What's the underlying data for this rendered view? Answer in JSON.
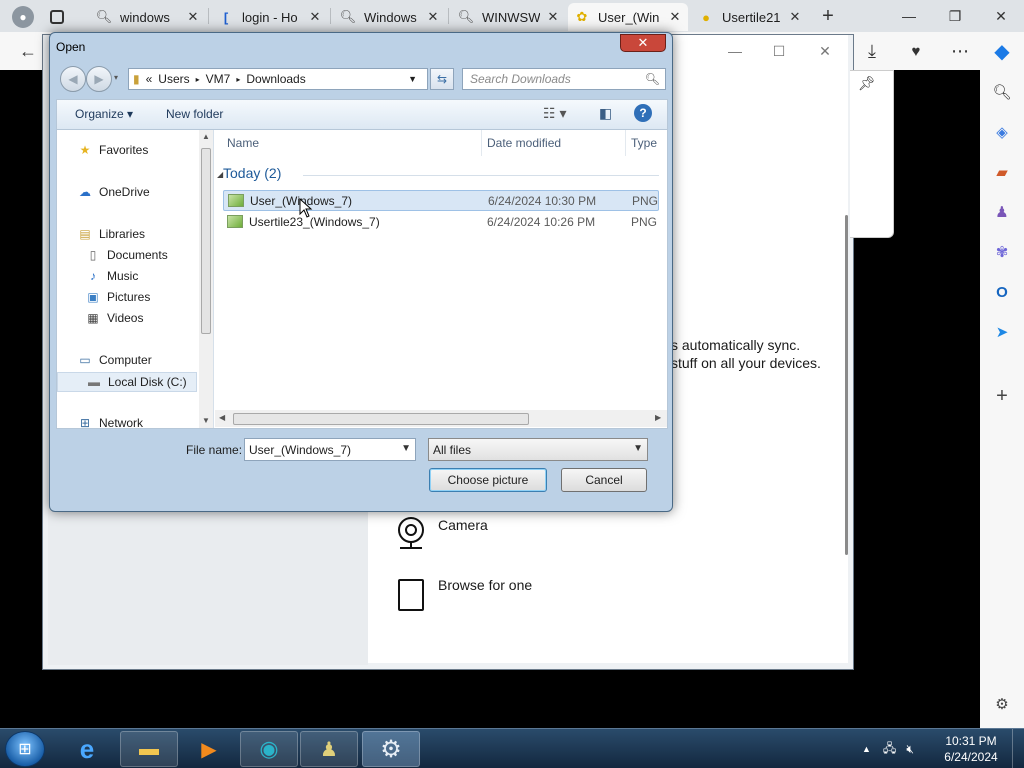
{
  "browser": {
    "tabs": [
      {
        "label": "windows",
        "icon": "search-icon"
      },
      {
        "label": "login - Ho",
        "icon": "link-icon"
      },
      {
        "label": "Windows",
        "icon": "search-icon"
      },
      {
        "label": "WINWSW",
        "icon": "search-icon"
      },
      {
        "label": "User_(Win",
        "icon": "gear-icon",
        "active": true
      },
      {
        "label": "Usertile21",
        "icon": "image-icon"
      }
    ],
    "controls": {
      "minimize": "—",
      "restore": "❐",
      "close": "✕",
      "new_tab": "+"
    }
  },
  "settings_window": {
    "sync_line_1": "s automatically sync.",
    "sync_line_2": "stuff on all your devices.",
    "camera_label": "Camera",
    "browse_label": "Browse for one"
  },
  "dialog": {
    "title": "Open",
    "breadcrumb": [
      "«",
      "Users",
      "VM7",
      "Downloads"
    ],
    "search_placeholder": "Search Downloads",
    "toolbar": {
      "organize": "Organize ▾",
      "new_folder": "New folder"
    },
    "nav": {
      "favorites": "Favorites",
      "onedrive": "OneDrive",
      "libraries": "Libraries",
      "documents": "Documents",
      "music": "Music",
      "pictures": "Pictures",
      "videos": "Videos",
      "computer": "Computer",
      "local_disk": "Local Disk (C:)",
      "network": "Network"
    },
    "columns": {
      "name": "Name",
      "date_modified": "Date modified",
      "type": "Type"
    },
    "group_header": "Today (2)",
    "files": [
      {
        "name": "User_(Windows_7)",
        "date": "6/24/2024 10:30 PM",
        "type": "PNG"
      },
      {
        "name": "Usertile23_(Windows_7)",
        "date": "6/24/2024 10:26 PM",
        "type": "PNG"
      }
    ],
    "file_name_label": "File name:",
    "file_name_value": "User_(Windows_7)",
    "file_type_value": "All files",
    "choose_button": "Choose picture",
    "cancel_button": "Cancel"
  },
  "taskbar": {
    "time": "10:31 PM",
    "date": "6/24/2024"
  }
}
